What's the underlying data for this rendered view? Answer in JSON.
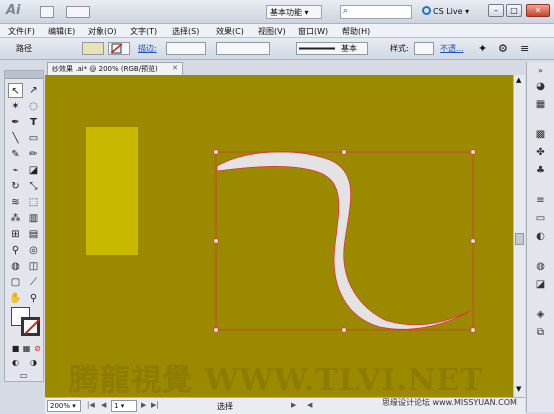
{
  "app": {
    "logo": "Ai",
    "workspace": "基本功能",
    "cs_live": "CS Live"
  },
  "menus": [
    "文件(F)",
    "编辑(E)",
    "对象(O)",
    "文字(T)",
    "选择(S)",
    "效果(C)",
    "视图(V)",
    "窗口(W)",
    "帮助(H)"
  ],
  "control_bar": {
    "selection_type": "路径",
    "stroke_label": "描边:",
    "brush_style": "基本",
    "style_label": "样式:",
    "opacity_label": "不透..."
  },
  "document": {
    "tab_title": "纱效果 .ai* @ 200% (RGB/预览)"
  },
  "canvas": {
    "watermark": "腾龍視覺 WWW.TLVI.NET",
    "background_color": "#9b8a00",
    "rect_color": "#c8b800",
    "shape_fill": "#e3e3e3",
    "selection_color": "#e4303a"
  },
  "status": {
    "zoom": "200%",
    "page": "1",
    "mode": "选择"
  },
  "credit": "思缘设计论坛 www.MISSYUAN.COM",
  "icons": [
    "selection-icon",
    "direct-selection-icon",
    "magic-wand-icon",
    "lasso-icon",
    "pen-icon",
    "type-icon",
    "line-icon",
    "rectangle-icon",
    "paintbrush-icon",
    "pencil-icon",
    "blob-brush-icon",
    "eraser-icon",
    "rotate-icon",
    "scale-icon",
    "warp-icon",
    "free-transform-icon",
    "symbol-sprayer-icon",
    "graph-icon",
    "mesh-icon",
    "gradient-icon",
    "eyedropper-icon",
    "blend-icon",
    "live-paint-icon",
    "live-paint-selection-icon",
    "artboard-icon",
    "slice-icon",
    "hand-icon",
    "zoom-icon"
  ]
}
